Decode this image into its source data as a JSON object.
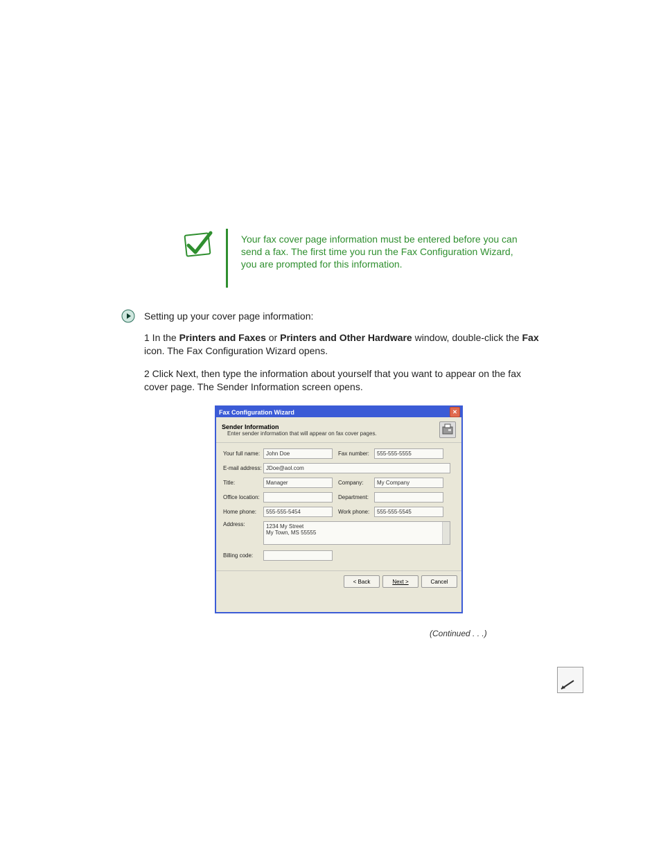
{
  "callout": {
    "text": "Your fax cover page information must be entered before you can send a fax. The first time you run the Fax Configuration Wizard, you are prompted for this information."
  },
  "lead": "Setting up your cover page information:",
  "step1_a": "1  In the",
  "step1_b": "Printers and Faxes",
  "step1_c": "or",
  "step1_d": "Printers and Other Hardware",
  "step1_e": "window, double-click the",
  "step1_f": "Fax",
  "step1_g": "icon. The Fax Configuration Wizard opens.",
  "step2": "2  Click Next, then type the information about yourself that you want to appear on the fax cover page. The Sender Information screen opens.",
  "wizard": {
    "title": "Fax Configuration Wizard",
    "header": "Sender Information",
    "sub": "Enter sender information that will appear on fax cover pages.",
    "full_name_label": "Your full name:",
    "full_name": "John Doe",
    "fax_number_label": "Fax number:",
    "fax_number": "555-555-5555",
    "email_label": "E-mail address:",
    "email": "JDoe@aol.com",
    "title_label": "Title:",
    "title_v": "Manager",
    "company_label": "Company:",
    "company": "My Company",
    "office_label": "Office location:",
    "office": "",
    "department_label": "Department:",
    "department": "",
    "homephone_label": "Home phone:",
    "homephone": "555-555-5454",
    "workphone_label": "Work phone:",
    "workphone": "555-555-5545",
    "address_label": "Address:",
    "address1": "1234 My Street",
    "address2": "My Town, MS 55555",
    "billing_label": "Billing code:",
    "billing": "",
    "back": "< Back",
    "next": "Next >",
    "cancel": "Cancel"
  },
  "continued": "(Continued . . .)",
  "icons": {
    "checkmark": "checkmark-icon",
    "play": "play-icon",
    "fax": "fax-icon",
    "close": "close-icon",
    "arrow": "arrow-icon"
  }
}
